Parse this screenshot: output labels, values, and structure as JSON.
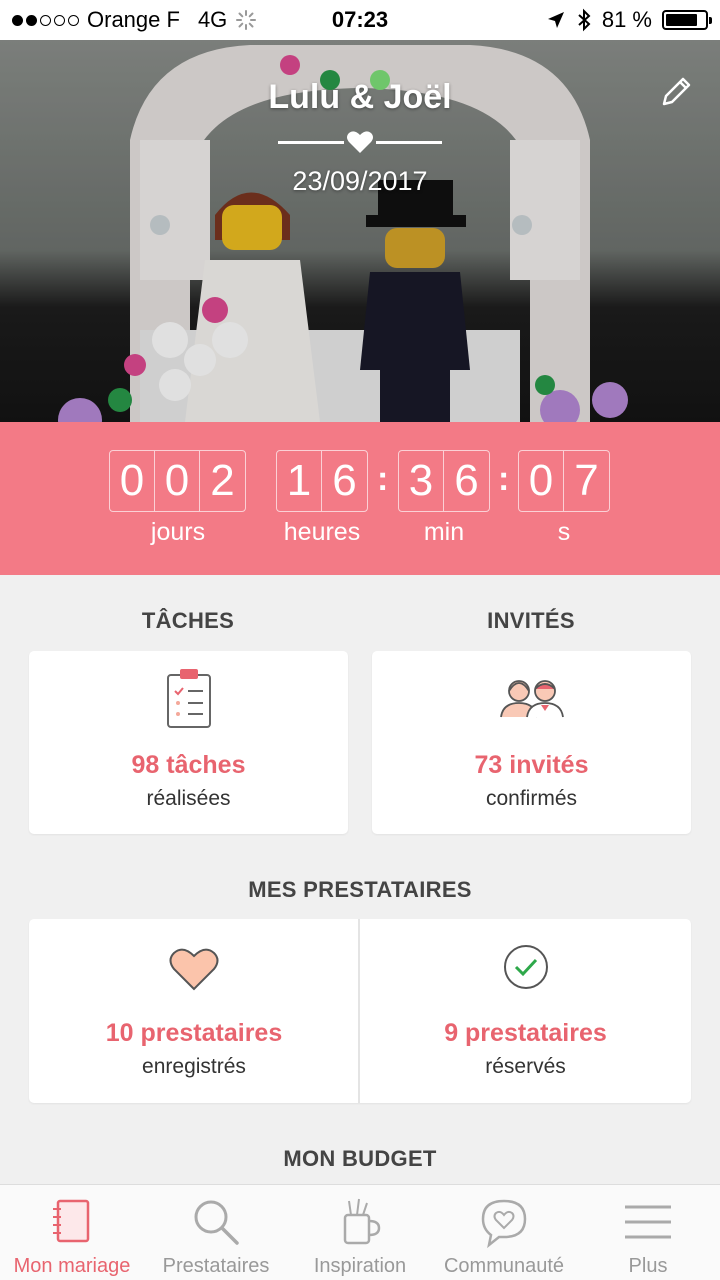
{
  "status_bar": {
    "carrier": "Orange F",
    "network": "4G",
    "time": "07:23",
    "battery": "81 %",
    "battery_level": 0.81
  },
  "hero": {
    "couple": "Lulu & Joël",
    "date": "23/09/2017"
  },
  "countdown": {
    "days": [
      "0",
      "0",
      "2"
    ],
    "hours": [
      "1",
      "6"
    ],
    "minutes": [
      "3",
      "6"
    ],
    "seconds": [
      "0",
      "7"
    ],
    "separator": ":",
    "labels": {
      "days": "jours",
      "hours": "heures",
      "minutes": "min",
      "seconds": "s"
    }
  },
  "tasks": {
    "title": "TÂCHES",
    "value": "98 tâches",
    "sub": "réalisées"
  },
  "guests": {
    "title": "INVITÉS",
    "value": "73 invités",
    "sub": "confirmés"
  },
  "vendors": {
    "title": "MES PRESTATAIRES",
    "saved_value": "10 prestataires",
    "saved_sub": "enregistrés",
    "booked_value": "9 prestataires",
    "booked_sub": "réservés"
  },
  "budget": {
    "title": "MON BUDGET"
  },
  "nav": {
    "items": [
      {
        "label": "Mon mariage",
        "icon": "notebook-icon"
      },
      {
        "label": "Prestataires",
        "icon": "search-icon"
      },
      {
        "label": "Inspiration",
        "icon": "mug-icon"
      },
      {
        "label": "Communauté",
        "icon": "chat-heart-icon"
      },
      {
        "label": "Plus",
        "icon": "menu-icon"
      }
    ]
  },
  "colors": {
    "accent": "#f37a86",
    "accent_text": "#e8646f",
    "background": "#f0f0f0"
  }
}
